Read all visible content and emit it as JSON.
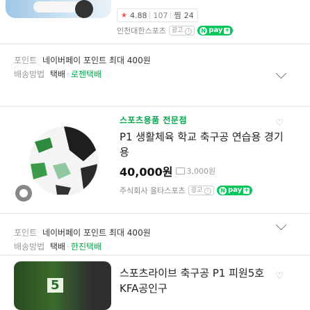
{
  "item1": {
    "rating": "4.88",
    "review_count": "107",
    "purchase_count": "24",
    "shop": "인천대한스포츠",
    "ad_label": "광고",
    "npay_label": "pay",
    "shipping_points_label": "포인트",
    "points_text": "네이버페이 포인트 최대 400원",
    "shipping_label": "배송방법",
    "shipping_method": "택배",
    "courier": "로젠택배"
  },
  "item2": {
    "brand": "스포츠용품 전문점",
    "title": "P1 생활체육 학교 축구공 연습용 경기용",
    "price": "40,000원",
    "shipping_fee": "3,000원",
    "shop": "주식회사 올타스포츠",
    "ad_label": "광고",
    "npay_label": "pay",
    "shipping_points_label": "포인트",
    "points_text": "네이버페이 포인트 최대 400원",
    "shipping_label": "배송방법",
    "shipping_method": "택배",
    "courier": "한진택배"
  },
  "item3": {
    "title": "스포츠라이브 축구공 P1 피원5호 KFA공인구",
    "thumb_text": "5"
  },
  "colors": {
    "accent_green": "#03c75a",
    "star_red": "#ff4d4f"
  }
}
